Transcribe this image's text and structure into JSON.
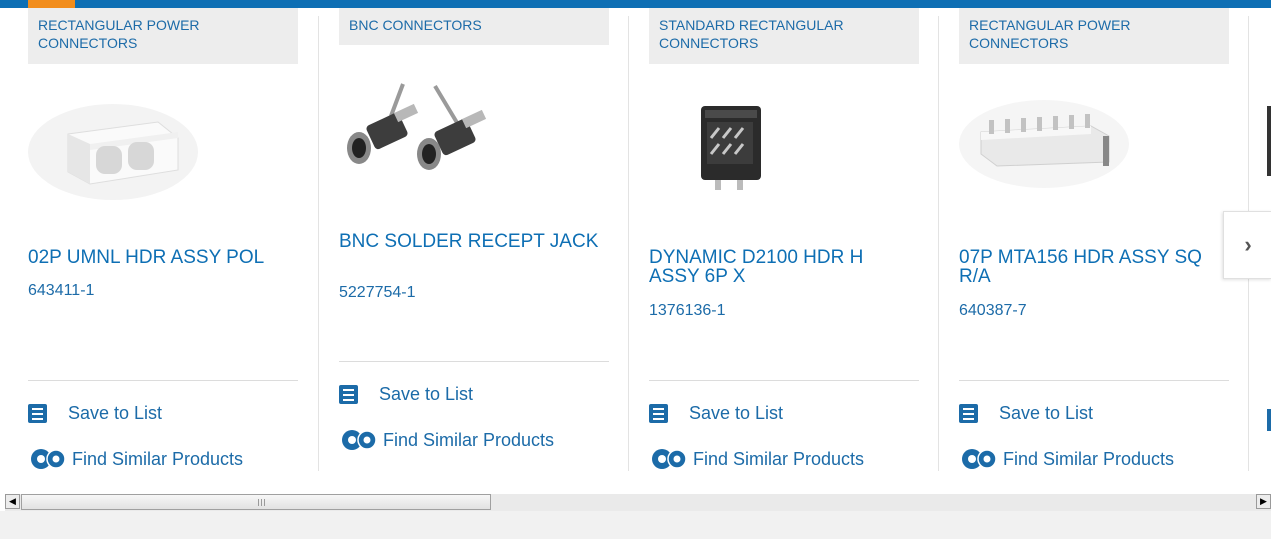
{
  "cards": [
    {
      "category": "RECTANGULAR POWER CONNECTORS",
      "title": "02P UMNL HDR ASSY POL",
      "part_number": "643411-1",
      "save_label": "Save to List",
      "similar_label": "Find Similar Products",
      "image": "two-position-power-header"
    },
    {
      "category": "BNC CONNECTORS",
      "title": "BNC SOLDER RECEPT JACK",
      "part_number": "5227754-1",
      "save_label": "Save to List",
      "similar_label": "Find Similar Products",
      "image": "bnc-jack-pair"
    },
    {
      "category": "STANDARD RECTANGULAR CONNECTORS",
      "title": "DYNAMIC D2100 HDR H ASSY 6P X",
      "part_number": "1376136-1",
      "save_label": "Save to List",
      "similar_label": "Find Similar Products",
      "image": "black-header-block"
    },
    {
      "category": "RECTANGULAR POWER CONNECTORS",
      "title": "07P MTA156 HDR ASSY SQ R/A",
      "part_number": "640387-7",
      "save_label": "Save to List",
      "similar_label": "Find Similar Products",
      "image": "right-angle-pin-header"
    }
  ],
  "icons": {
    "save": "checklist-icon",
    "similar": "gears-icon",
    "next": "chevron-right-icon"
  },
  "carousel": {
    "next_label": "›"
  },
  "colors": {
    "brand_blue": "#0e6fb4",
    "accent_orange": "#f28d1c",
    "category_bg": "#ededed"
  }
}
